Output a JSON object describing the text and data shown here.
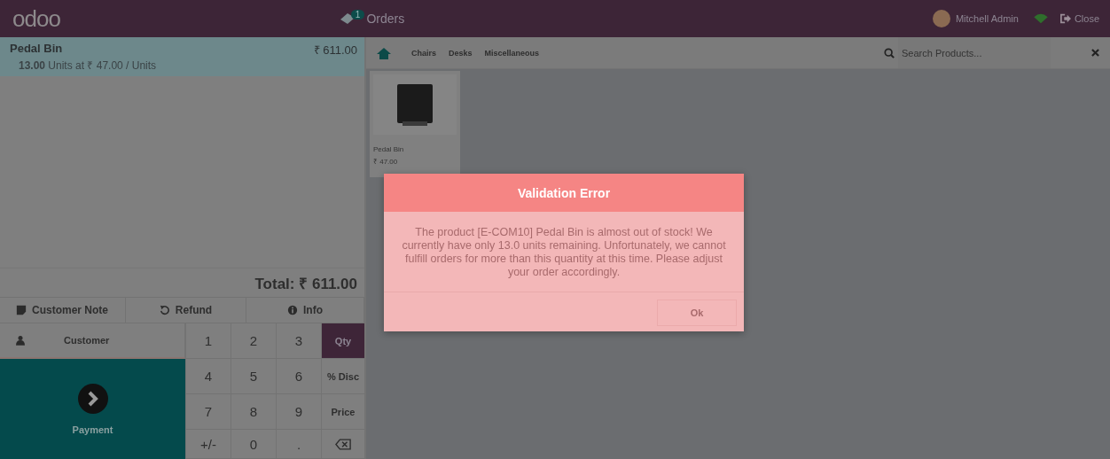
{
  "header": {
    "logo": "odoo",
    "orders": {
      "count": "1",
      "label": "Orders"
    },
    "user": "Mitchell Admin",
    "close": "Close"
  },
  "order": {
    "lines": [
      {
        "name": "Pedal Bin",
        "qty": "13.00",
        "detail": "Units at ₹ 47.00 / Units",
        "price": "₹ 611.00",
        "selected": true
      }
    ],
    "total": "Total: ₹ 611.00"
  },
  "actions": [
    "Customer Note",
    "Refund",
    "Info"
  ],
  "customer": "Customer",
  "payment": "Payment",
  "numpad": [
    {
      "keys": [
        "1",
        "2",
        "3"
      ],
      "side": {
        "kind": "mode",
        "label": "Qty",
        "selected": true
      }
    },
    {
      "keys": [
        "4",
        "5",
        "6"
      ],
      "side": {
        "kind": "mode",
        "label": "% Disc",
        "selected": false
      }
    },
    {
      "keys": [
        "7",
        "8",
        "9"
      ],
      "side": {
        "kind": "mode",
        "label": "Price",
        "selected": false
      }
    },
    {
      "keys": [
        "+/-",
        "0",
        "."
      ],
      "side": {
        "kind": "backspace"
      }
    }
  ],
  "categories": [
    "Chairs",
    "Desks",
    "Miscellaneous"
  ],
  "search": {
    "placeholder": "Search Products..."
  },
  "products": [
    {
      "name": "Pedal Bin",
      "price": "₹ 47.00"
    }
  ],
  "dialog": {
    "title": "Validation Error",
    "body": "The product [E-COM10] Pedal Bin is almost out of stock! We currently have only 13.0 units remaining. Unfortunately, we cannot fulfill orders for more than this quantity at this time. Please adjust your order accordingly.",
    "button": "Ok"
  }
}
